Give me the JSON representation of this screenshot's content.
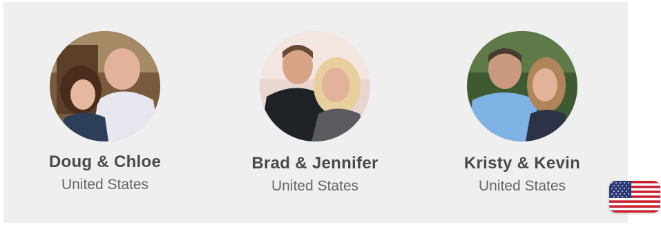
{
  "testimonials": [
    {
      "name": "Doug & Chloe",
      "country": "United States",
      "photo_icon": "couple-photo"
    },
    {
      "name": "Brad & Jennifer",
      "country": "United States",
      "photo_icon": "couple-photo"
    },
    {
      "name": "Kristy & Kevin",
      "country": "United States",
      "photo_icon": "couple-photo"
    }
  ],
  "country_selector": {
    "icon": "us-flag-icon",
    "country": "United States"
  },
  "colors": {
    "panel_bg": "#efefef",
    "name_text": "#4a4a4a",
    "country_text": "#666666"
  }
}
